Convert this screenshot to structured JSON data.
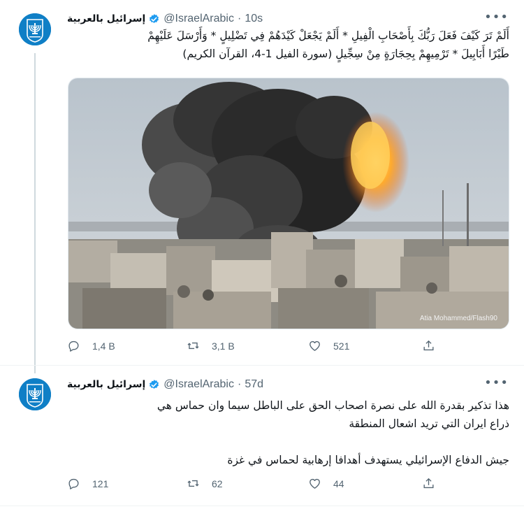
{
  "tweets": [
    {
      "display_name": "إسرائيل بالعربية",
      "handle": "@IsraelArabic",
      "separator": "·",
      "time": "10s",
      "text_lines": [
        "أَلَمْ تَرَ كَيْفَ فَعَلَ رَبُّكَ بِأَصْحَابِ الْفِيلِ * أَلَمْ يَجْعَلْ كَيْدَهُمْ فِي تَضْلِيلٍ * وَأَرْسَلَ عَلَيْهِمْ",
        "طَيْرًا أَبَابِيلَ * تَرْمِيهِمْ بِحِجَارَةٍ مِنْ سِجِّيلٍ (سورة الفيل 1-4، القرآن الكريم)"
      ],
      "image_credit": "Atia Mohammed/Flash90",
      "replies": "1,4 B",
      "retweets": "3,1 B",
      "likes": "521"
    },
    {
      "display_name": "إسرائيل بالعربية",
      "handle": "@IsraelArabic",
      "separator": "·",
      "time": "57d",
      "text_lines": [
        "هذا تذكير بقدرة الله على نصرة اصحاب الحق على الباطل سيما وان حماس هي",
        "ذراع ايران التي تريد اشعال المنطقة",
        "جيش الدفاع الإسرائيلي يستهدف أهدافا إرهابية لحماس في غزة"
      ],
      "replies": "121",
      "retweets": "62",
      "likes": "44"
    }
  ],
  "icons": [
    "emblem-avatar-icon",
    "verified-badge-icon",
    "more-options-icon",
    "reply-icon",
    "retweet-icon",
    "like-icon",
    "share-icon"
  ],
  "colors": {
    "secondary_text": "#536471",
    "verified_blue": "#1d9bf0",
    "avatar_blue": "#0f7fc6",
    "thread_line": "#cfd9de"
  }
}
